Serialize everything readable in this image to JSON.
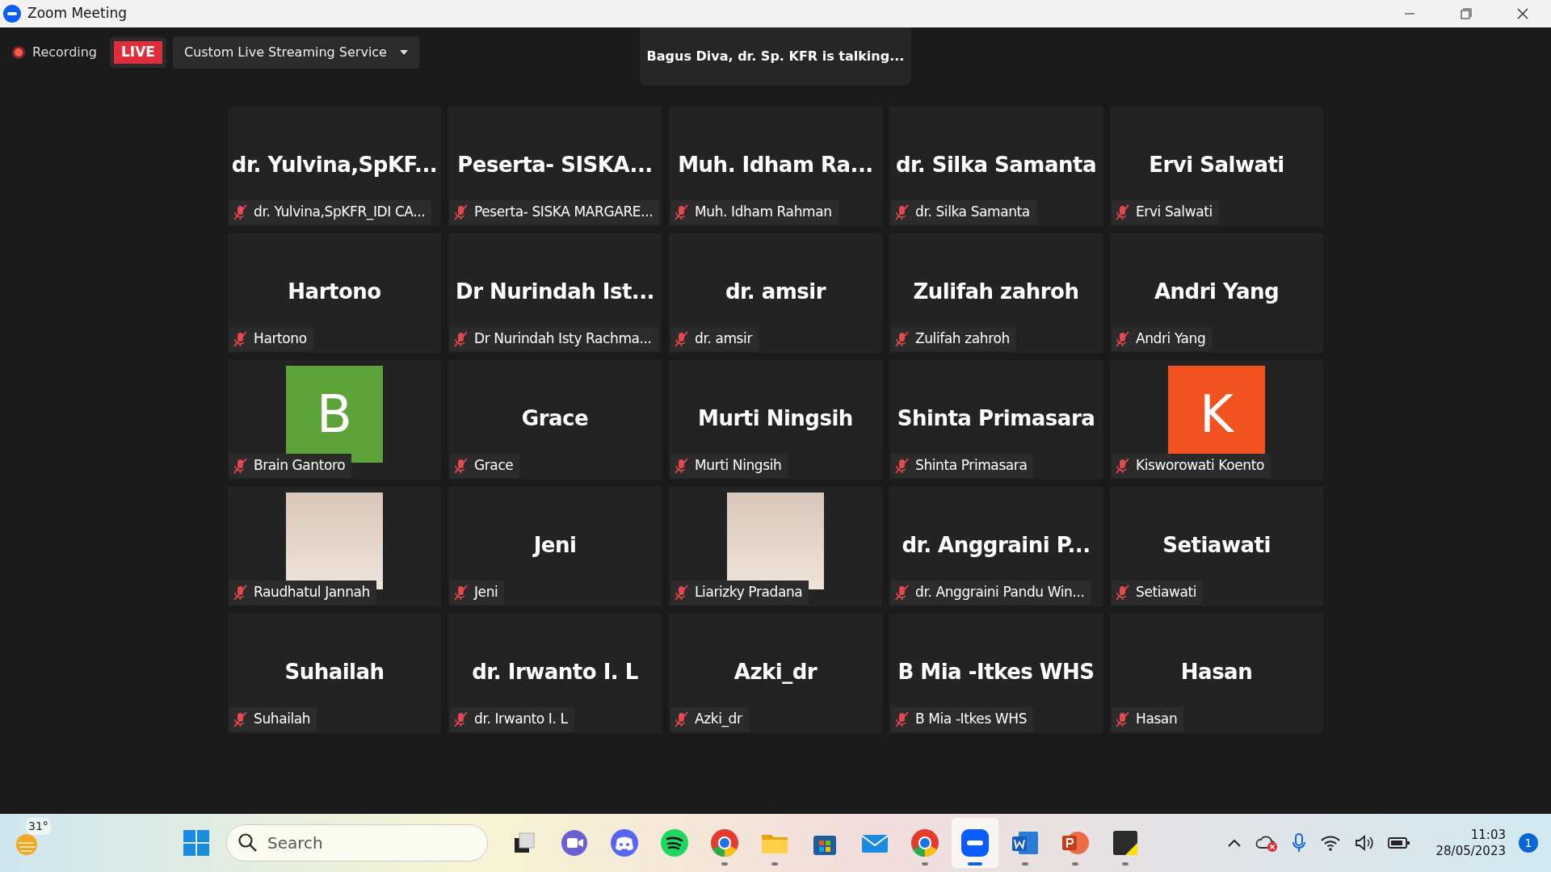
{
  "window": {
    "title": "Zoom Meeting"
  },
  "toolbar": {
    "recording": "Recording",
    "live_badge": "LIVE",
    "streaming_service": "Custom Live Streaming Service"
  },
  "talking_indicator": "Bagus Diva, dr. Sp. KFR is talking...",
  "tiles": [
    {
      "kind": "name",
      "display": "dr.  Yulvina,SpKF...",
      "label": "dr. Yulvina,SpKFR_IDI CA...",
      "muted": true
    },
    {
      "kind": "name",
      "display": "Peserta-  SISKA...",
      "label": "Peserta- SISKA MARGARE...",
      "muted": true
    },
    {
      "kind": "name",
      "display": "Muh.  Idham  Ra...",
      "label": "Muh. Idham Rahman",
      "muted": true
    },
    {
      "kind": "name",
      "display": "dr. Silka Samanta",
      "label": "dr. Silka Samanta",
      "muted": true
    },
    {
      "kind": "name",
      "display": "Ervi Salwati",
      "label": "Ervi Salwati",
      "muted": true
    },
    {
      "kind": "name",
      "display": "Hartono",
      "label": "Hartono",
      "muted": true
    },
    {
      "kind": "name",
      "display": "Dr  Nurindah  Ist...",
      "label": "Dr Nurindah Isty Rachma...",
      "muted": true
    },
    {
      "kind": "name",
      "display": "dr. amsir",
      "label": "dr. amsir",
      "muted": true
    },
    {
      "kind": "name",
      "display": "Zulifah zahroh",
      "label": "Zulifah zahroh",
      "muted": true
    },
    {
      "kind": "name",
      "display": "Andri Yang",
      "label": "Andri Yang",
      "muted": true
    },
    {
      "kind": "avatar",
      "display": "B",
      "color": "#5ea33a",
      "label": "Brain Gantoro",
      "muted": true
    },
    {
      "kind": "name",
      "display": "Grace",
      "label": "Grace",
      "muted": true
    },
    {
      "kind": "name",
      "display": "Murti Ningsih",
      "label": "Murti Ningsih",
      "muted": true
    },
    {
      "kind": "name",
      "display": "Shinta Primasara",
      "label": "Shinta Primasara",
      "muted": true
    },
    {
      "kind": "avatar",
      "display": "K",
      "color": "#f2521f",
      "label": "Kisworowati Koento",
      "muted": true
    },
    {
      "kind": "photo",
      "label": "Raudhatul Jannah",
      "muted": true
    },
    {
      "kind": "name",
      "display": "Jeni",
      "label": "Jeni",
      "muted": true
    },
    {
      "kind": "photo",
      "label": "Liarizky Pradana",
      "muted": true
    },
    {
      "kind": "name",
      "display": "dr.  Anggraini  P...",
      "label": "dr. Anggraini Pandu Win...",
      "muted": true
    },
    {
      "kind": "name",
      "display": "Setiawati",
      "label": "Setiawati",
      "muted": true
    },
    {
      "kind": "name",
      "display": "Suhailah",
      "label": "Suhailah",
      "muted": true
    },
    {
      "kind": "name",
      "display": "dr. Irwanto I. L",
      "label": "dr. Irwanto I. L",
      "muted": true
    },
    {
      "kind": "name",
      "display": "Azki_dr",
      "label": "Azki_dr",
      "muted": true
    },
    {
      "kind": "name",
      "display": "B Mia -Itkes WHS",
      "label": "B Mia -Itkes WHS",
      "muted": true
    },
    {
      "kind": "name",
      "display": "Hasan",
      "label": "Hasan",
      "muted": true
    }
  ],
  "taskbar": {
    "weather": "31°",
    "search": {
      "placeholder": "Search"
    },
    "apps": [
      {
        "kind": "taskview",
        "running": false,
        "selected": false
      },
      {
        "kind": "meet",
        "running": false,
        "selected": false
      },
      {
        "kind": "discord",
        "running": false,
        "selected": false
      },
      {
        "kind": "spotify",
        "running": false,
        "selected": false
      },
      {
        "kind": "chrome",
        "running": true,
        "selected": false
      },
      {
        "kind": "folder",
        "running": true,
        "selected": false
      },
      {
        "kind": "store",
        "running": false,
        "selected": false
      },
      {
        "kind": "mail",
        "running": false,
        "selected": false
      },
      {
        "kind": "chrome",
        "running": true,
        "selected": false
      },
      {
        "kind": "zoom",
        "running": true,
        "selected": true
      },
      {
        "kind": "word",
        "running": true,
        "selected": false
      },
      {
        "kind": "powerpoint",
        "running": true,
        "selected": false
      },
      {
        "kind": "notes",
        "running": true,
        "selected": false
      }
    ],
    "time": "11:03",
    "date": "28/05/2023",
    "notifications": "1"
  }
}
